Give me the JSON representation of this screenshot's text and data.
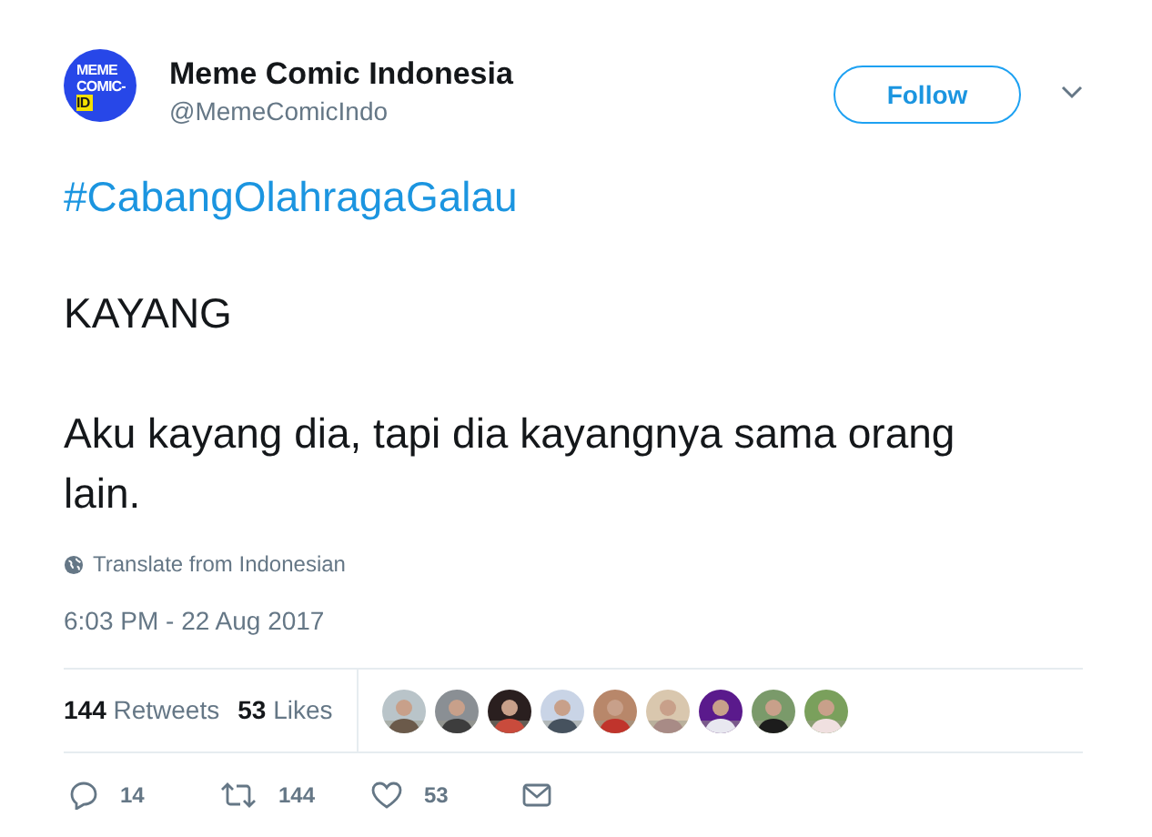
{
  "author": {
    "name": "Meme Comic Indonesia",
    "handle": "@MemeComicIndo",
    "logo_lines": [
      "MEME",
      "COMIC-",
      "ID"
    ]
  },
  "follow_button": {
    "label": "Follow"
  },
  "tweet": {
    "hashtag": "#CabangOlahragaGalau",
    "paragraphs": [
      "KAYANG",
      "Aku kayang dia, tapi dia kayangnya sama orang lain."
    ]
  },
  "translate_link": "Translate from Indonesian",
  "timestamp": "6:03 PM - 22 Aug 2017",
  "stats": [
    {
      "count": "144",
      "label": "Retweets"
    },
    {
      "count": "53",
      "label": "Likes"
    }
  ],
  "actions": [
    {
      "kind": "reply",
      "count": "14"
    },
    {
      "kind": "retweet",
      "count": "144"
    },
    {
      "kind": "like",
      "count": "53"
    },
    {
      "kind": "message"
    }
  ]
}
